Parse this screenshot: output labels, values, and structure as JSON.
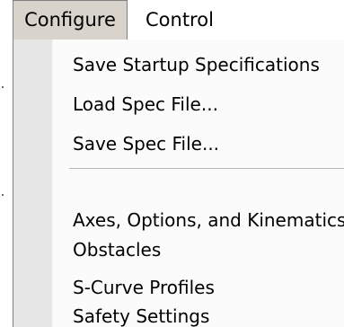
{
  "menubar": {
    "menus": [
      {
        "label": "Configure",
        "open": true
      },
      {
        "label": "Control",
        "open": false
      }
    ]
  },
  "dropdown": {
    "items": [
      {
        "label": "Save Startup Specifications"
      },
      {
        "label": "Load Spec File..."
      },
      {
        "label": "Save Spec File..."
      },
      {
        "separator": true
      },
      {
        "label": "Axes, Options, and Kinematics"
      },
      {
        "label": "Obstacles"
      },
      {
        "label": "S-Curve Profiles"
      },
      {
        "label": "Safety Settings"
      }
    ]
  },
  "colors": {
    "menu_background": "#fbfbfb",
    "gutter_background": "#e6e6e6",
    "open_title_background": "#d8d4cc",
    "border": "#808080"
  }
}
